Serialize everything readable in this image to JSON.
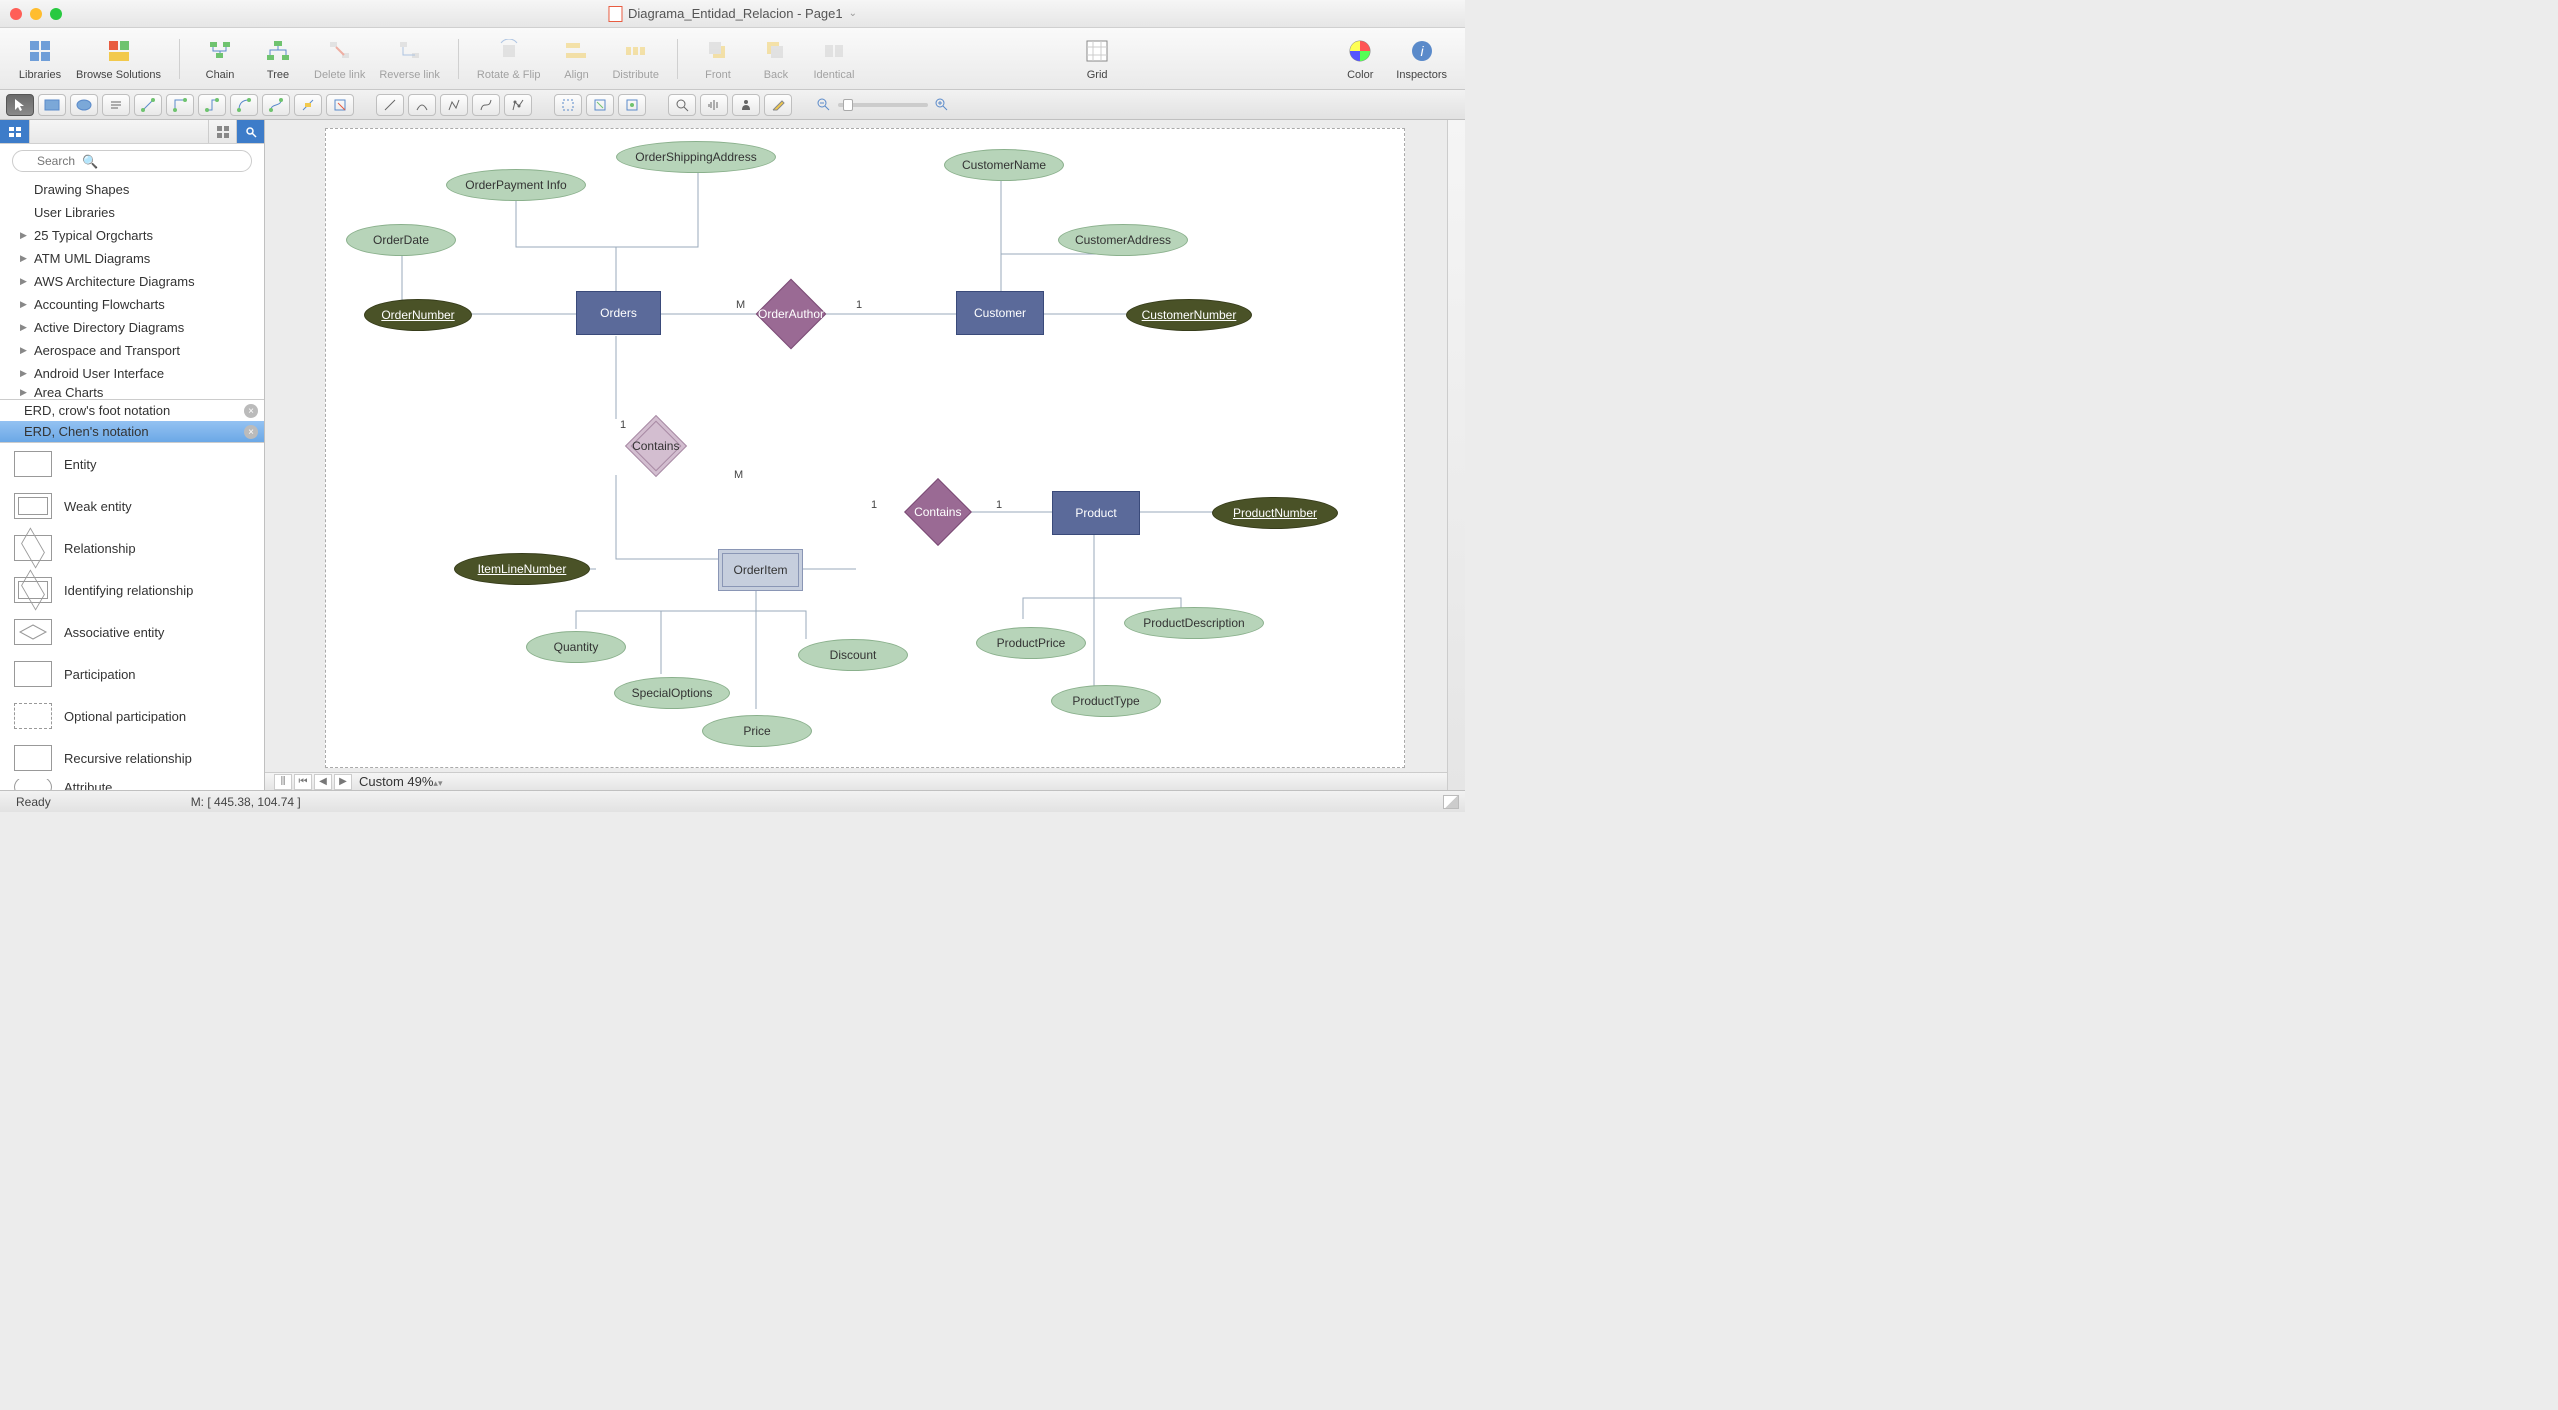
{
  "window": {
    "title": "Diagrama_Entidad_Relacion - Page1"
  },
  "toolbar": {
    "libraries": "Libraries",
    "browse": "Browse Solutions",
    "chain": "Chain",
    "tree": "Tree",
    "delete_link": "Delete link",
    "reverse_link": "Reverse link",
    "rotate_flip": "Rotate & Flip",
    "align": "Align",
    "distribute": "Distribute",
    "front": "Front",
    "back": "Back",
    "identical": "Identical",
    "grid": "Grid",
    "color": "Color",
    "inspectors": "Inspectors"
  },
  "sidebar": {
    "search_placeholder": "Search",
    "categories": [
      "Drawing Shapes",
      "User Libraries",
      "25 Typical Orgcharts",
      "ATM UML Diagrams",
      "AWS Architecture Diagrams",
      "Accounting Flowcharts",
      "Active Directory Diagrams",
      "Aerospace and Transport",
      "Android User Interface",
      "Area Charts"
    ],
    "tabs": {
      "crowfoot": "ERD, crow's foot notation",
      "chen": "ERD, Chen's notation"
    },
    "shapes": [
      "Entity",
      "Weak entity",
      "Relationship",
      "Identifying relationship",
      "Associative entity",
      "Participation",
      "Optional participation",
      "Recursive relationship",
      "Attribute"
    ]
  },
  "diagram": {
    "entities": {
      "orders": "Orders",
      "customer": "Customer",
      "order_item": "OrderItem",
      "product": "Product"
    },
    "relationships": {
      "order_author": "OrderAuthor",
      "contains1": "Contains",
      "contains2": "Contains"
    },
    "attributes": {
      "order_date": "OrderDate",
      "order_payment": "OrderPayment Info",
      "order_shipping": "OrderShippingAddress",
      "order_number": "OrderNumber",
      "customer_name": "CustomerName",
      "customer_address": "CustomerAddress",
      "customer_number": "CustomerNumber",
      "item_line_number": "ItemLineNumber",
      "quantity": "Quantity",
      "special_options": "SpecialOptions",
      "price": "Price",
      "discount": "Discount",
      "product_number": "ProductNumber",
      "product_description": "ProductDescription",
      "product_price": "ProductPrice",
      "product_type": "ProductType"
    },
    "cardinality": {
      "m": "M",
      "one": "1"
    }
  },
  "status": {
    "ready": "Ready",
    "zoom": "Custom 49%",
    "mouse": "M: [ 445.38, 104.74 ]"
  }
}
